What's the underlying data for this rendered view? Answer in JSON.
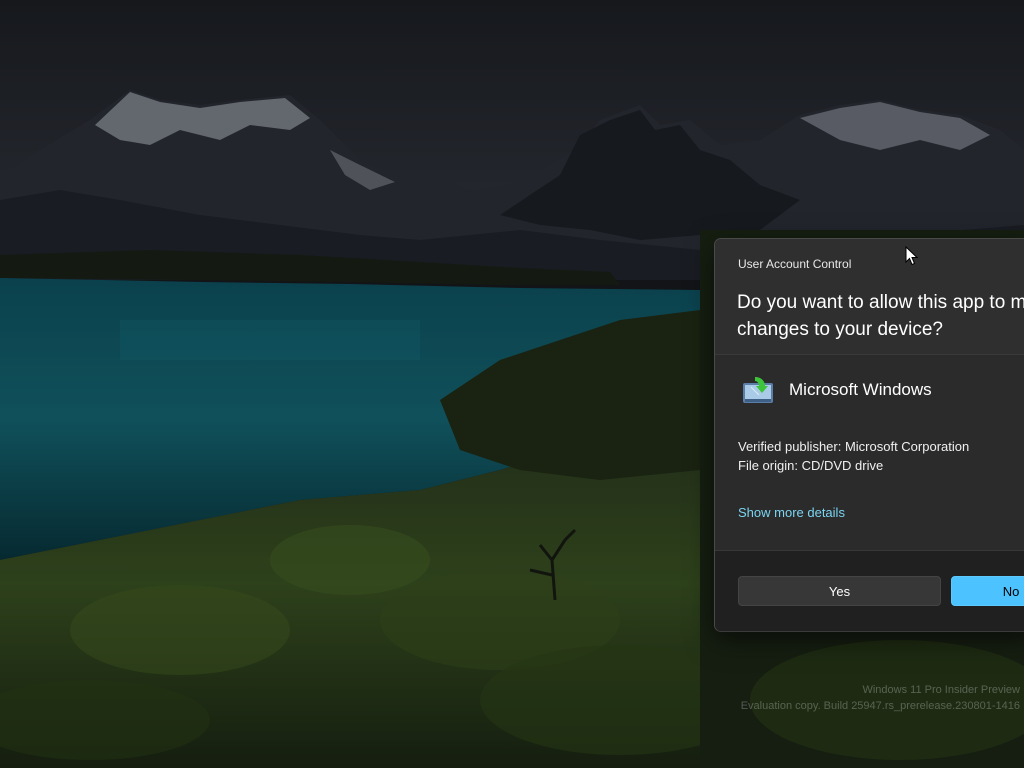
{
  "wallpaper": {
    "sky_color": "#23262c",
    "lake_color": "#0f5462",
    "vegetation_color": "#2c4a1f"
  },
  "watermark": {
    "line1": "Windows 11 Pro Insider Preview",
    "line2": "Evaluation copy. Build 25947.rs_prerelease.230801-1416"
  },
  "uac": {
    "title": "User Account Control",
    "question_line1": "Do you want to allow this app to make",
    "question_line2": "changes to your device?",
    "app_icon": "windows-installer-icon",
    "app_name": "Microsoft Windows",
    "publisher": "Verified publisher: Microsoft Corporation",
    "origin": "File origin: CD/DVD drive",
    "details_link": "Show more details",
    "yes_label": "Yes",
    "no_label": "No",
    "accent_color": "#4cc2ff",
    "link_color": "#7ad4f2"
  },
  "cursor": {
    "icon": "arrow-cursor-icon"
  }
}
